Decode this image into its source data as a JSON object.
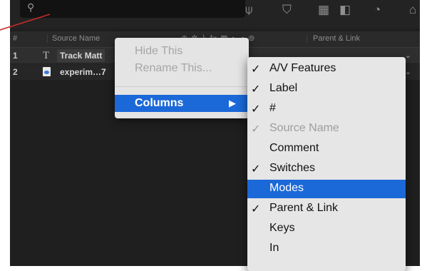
{
  "toolbar": {
    "search_icon_glyph": "⚲",
    "tools": [
      {
        "name": "shy-icon",
        "glyph": "⍦"
      },
      {
        "name": "draft-3d-icon",
        "glyph": "⛉"
      },
      {
        "name": "frame-blending-icon",
        "glyph": "▦"
      },
      {
        "name": "motion-blur-icon",
        "glyph": "◧"
      },
      {
        "name": "graph-editor-icon",
        "glyph": "◔"
      },
      {
        "name": "chart-icon",
        "glyph": "⌂"
      }
    ]
  },
  "columns": {
    "hash": "#",
    "source_name": "Source Name",
    "switches_glyphs": "⊕ ✲ ∖ fx ▦ ◐ ◑ ⊚",
    "parent_link": "Parent & Link"
  },
  "layers": [
    {
      "num": "1",
      "type_glyph": "T",
      "name": "Track Matt"
    },
    {
      "num": "2",
      "type_glyph": "",
      "name": "experim…7"
    }
  ],
  "context_menu": {
    "hide": "Hide This",
    "rename": "Rename This...",
    "columns": "Columns",
    "arrow": "▶"
  },
  "columns_submenu": [
    {
      "check": "✓",
      "label": "A/V Features",
      "state": "normal"
    },
    {
      "check": "✓",
      "label": "Label",
      "state": "normal"
    },
    {
      "check": "✓",
      "label": "#",
      "state": "normal"
    },
    {
      "check": "✓",
      "label": "Source Name",
      "state": "dim"
    },
    {
      "check": "",
      "label": "Comment",
      "state": "normal"
    },
    {
      "check": "✓",
      "label": "Switches",
      "state": "normal"
    },
    {
      "check": "",
      "label": "Modes",
      "state": "selected"
    },
    {
      "check": "✓",
      "label": "Parent & Link",
      "state": "normal"
    },
    {
      "check": "",
      "label": "Keys",
      "state": "normal"
    },
    {
      "check": "",
      "label": "In",
      "state": "normal"
    }
  ],
  "colors": {
    "highlight": "#1b68d8",
    "annotation_line": "#c62a2a"
  }
}
